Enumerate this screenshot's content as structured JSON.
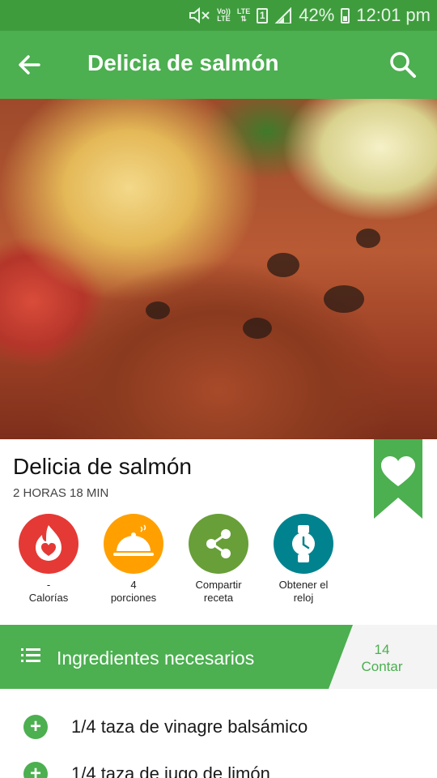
{
  "status_bar": {
    "volte": [
      "Vo))",
      "LTE"
    ],
    "lte": "LTE",
    "sim": "1",
    "battery": "42%",
    "time": "12:01 pm"
  },
  "toolbar": {
    "title": "Delicia de salmón",
    "back_icon": "arrow-back-icon",
    "search_icon": "search-icon"
  },
  "hero": {
    "description_icon": "salmon-photo"
  },
  "recipe": {
    "title": "Delicia de salmón",
    "time": "2 HORAS 18 MIN",
    "bookmark_icon": "heart-bookmark-icon"
  },
  "actions": [
    {
      "value": "-",
      "label": "Calorías",
      "icon": "flame-heart-icon",
      "color": "#e53935"
    },
    {
      "value": "4",
      "label": "porciones",
      "icon": "serving-cloche-icon",
      "color": "#ffa000"
    },
    {
      "label_line1": "Compartir",
      "label_line2": "receta",
      "icon": "share-icon",
      "color": "#689f38"
    },
    {
      "label_line1": "Obtener el",
      "label_line2": "reloj",
      "icon": "watch-icon",
      "color": "#00838f"
    }
  ],
  "ingredients": {
    "header": "Ingredientes necesarios",
    "count": "14",
    "count_label": "Contar",
    "items": [
      "1/4 taza de vinagre balsámico",
      "1/4 taza de jugo de limón"
    ]
  },
  "colors": {
    "primary": "#4caf50",
    "status": "#3f9c3d"
  }
}
